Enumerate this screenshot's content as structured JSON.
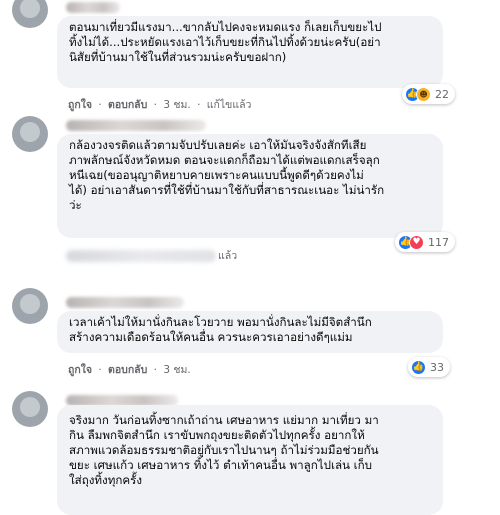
{
  "comments": [
    {
      "lines": [
        "ตอนมาเที่ยวมีแรงมา...ขากลับไปคงจะหมดแรง ก็เลยเก็บขยะไป",
        "ทิ้งไม่ได้...ประหยัดแรงเอาไว้เก็บขยะที่กินไปทิ้งด้วยน่ะครับ(อย่า",
        "นิสัยที่บ้านมาใช้ในที่ส่วนรวมน่ะครับขอฝาก)"
      ],
      "like_label": "ถูกใจ",
      "reply_label": "ตอบกลับ",
      "time": "3 ชม.",
      "edited": "แก้ไขแล้ว",
      "reaction_count": "22",
      "reaction_icons": [
        "like-icon",
        "haha-icon"
      ]
    },
    {
      "lines": [
        "กล้องวงจรติดแล้วตามจับปรับเลยค่ะ เอาให้มันจริงจังสักทีเสีย",
        "ภาพลักษณ์จังหวัดหมด ตอนจะแดกก็ถือมาได้แต่พอแดกเสร็จลุก",
        "หนีเฉย(ขออนุญาติหยาบคายเพราะคนแบบนี้พูดดีๆด้วยคงไม่",
        "ได้) อย่าเอาสันดารที่ใช้ที่บ้านมาใช้กับที่สาธารณะเนอะ ไม่น่ารัก",
        "ว่ะ"
      ],
      "partial_action": "แล้ว",
      "reaction_count": "117",
      "reaction_icons": [
        "like-icon",
        "love-icon"
      ]
    },
    {
      "lines": [
        "เวลาเค้าไม่ให้มานั่งกินละโวยวาย พอมานั่งกินละไม่มีจิตสำนึก",
        "สร้างความเดือดร้อนให้คนอื่น ควรนะควรเอาอย่างดีๆแม่ม"
      ],
      "like_label": "ถูกใจ",
      "reply_label": "ตอบกลับ",
      "time": "3 ชม.",
      "reaction_count": "33",
      "reaction_icons": [
        "like-icon"
      ]
    },
    {
      "lines": [
        "จริงมาก วันก่อนทิ้งซากเถ้าถ่าน เศษอาหาร แย่มาก มาเที่ยว มา",
        "กิน ลืมพกจิตสำนึก เราขับพกถุงขยะติดตัวไปทุกครั้ง อยากให้",
        "สภาพแวดล้อมธรรมชาติอยู่กับเราไปนานๆ ถ้าไม่ร่วมมือช่วยกัน",
        "ขยะ เศษแก้ว เศษอาหาร ทิ้งไว้ ตำเท้าคนอื่น พาลูกไปเล่น เก็บ",
        "ใส่ถุงทิ้งทุกครั้ง"
      ]
    }
  ]
}
